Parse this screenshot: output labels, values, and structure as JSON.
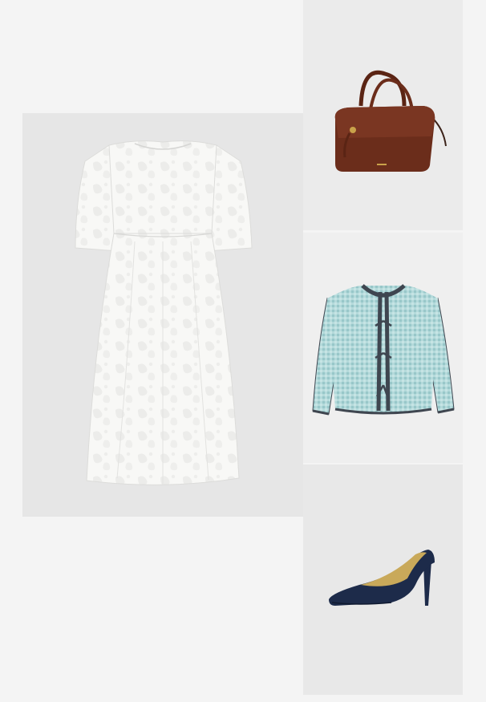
{
  "outfit": {
    "items": [
      {
        "name": "white-lace-dress",
        "bg": "#e6e6e6"
      },
      {
        "name": "brown-leather-handbag",
        "bg": "#ebebeb"
      },
      {
        "name": "light-blue-tweed-jacket",
        "bg": "#efefef"
      },
      {
        "name": "navy-suede-pump",
        "bg": "#e8e8e8"
      }
    ],
    "colors": {
      "page_bg": "#f4f4f4",
      "dress": "#f7f7f5",
      "bag": "#6b2d1b",
      "jacket": "#a9d2d3",
      "jacket_trim": "#3f4650",
      "shoe": "#1d2b4a"
    }
  }
}
